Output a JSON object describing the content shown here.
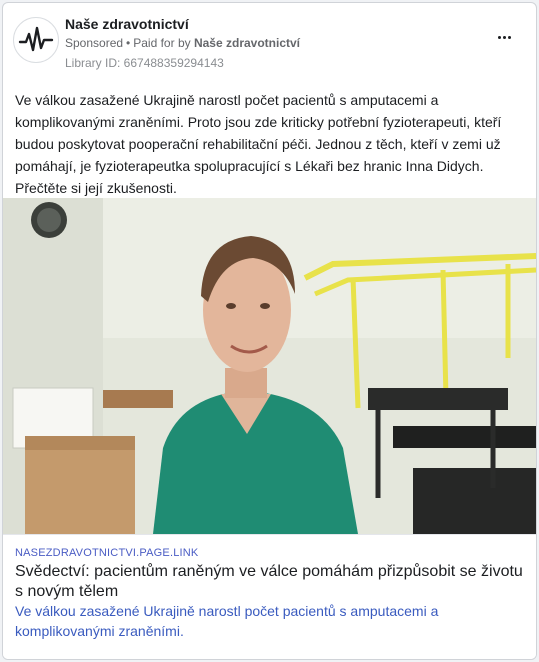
{
  "post": {
    "page_name": "Naše zdravotnictví",
    "sponsored": "Sponsored",
    "paid_for_prefix": "Paid for by",
    "paid_for_name": "Naše zdravotnictví",
    "library_id": "Library ID: 667488359294143",
    "more_icon": "more-options-icon",
    "avatar_icon": "heartbeat-logo-icon",
    "body": "Ve válkou zasažené Ukrajině narostl počet pacientů s amputacemi a komplikovanými zraněními. Proto jsou zde kriticky potřební fyzioterapeuti, kteří budou poskytovat pooperační rehabilitační péči. Jednou z těch, kteří v zemi už pomáhají, je fyzioterapeutka spolupracující s Lékaři bez hranic Inna Didych. Přečtěte si její zkušenosti."
  },
  "link": {
    "domain": "NASEZDRAVOTNICTVI.PAGE.LINK",
    "title": "Svědectví: pacientům raněným ve válce pomáhám přizpůsobit se životu s novým tělem",
    "description": "Ve válkou zasažené Ukrajině narostl počet pacientů s amputacemi a komplikovanými zraněními."
  },
  "colors": {
    "link_blue": "#3a5bbf",
    "shirt_teal": "#1f8c73",
    "rail_yellow": "#e8e24a"
  }
}
